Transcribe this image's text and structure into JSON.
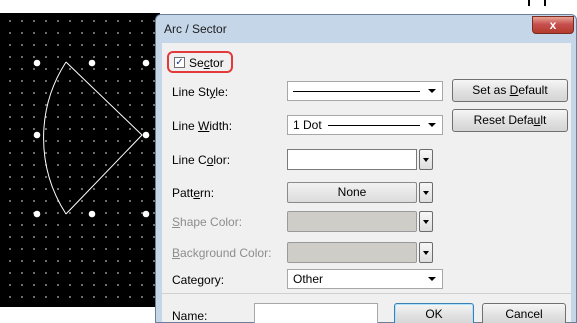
{
  "dialog": {
    "title": "Arc / Sector",
    "close_glyph": "x"
  },
  "sector": {
    "label_pre": "Se",
    "label_u": "c",
    "label_post": "tor",
    "checked": true,
    "check_glyph": "✓"
  },
  "fields": {
    "line_style": {
      "pre": "Line St",
      "u": "y",
      "post": "le:"
    },
    "line_width": {
      "pre": "Line ",
      "u": "W",
      "post": "idth:",
      "value": "1 Dot"
    },
    "line_color": {
      "pre": "Line C",
      "u": "o",
      "post": "lor:"
    },
    "pattern": {
      "pre": "Patt",
      "u": "e",
      "post": "rn:",
      "value": "None"
    },
    "shape_color": {
      "pre": "",
      "u": "S",
      "post": "hape Color:"
    },
    "background_color": {
      "pre": "",
      "u": "B",
      "post": "ackground Color:"
    },
    "category": {
      "pre": "Cate",
      "u": "g",
      "post": "ory:",
      "value": "Other"
    },
    "name": {
      "label": "Name:",
      "value": ""
    }
  },
  "buttons": {
    "set_default": {
      "pre": "Set as ",
      "u": "D",
      "post": "efault"
    },
    "reset_default": {
      "pre": "Reset Defa",
      "u": "u",
      "post": "lt"
    },
    "ok": "OK",
    "cancel": "Cancel"
  },
  "colors": {
    "canvas": "#000000",
    "shape_stroke": "#ffffff",
    "highlight": "#e23a3a",
    "dialog_frame": "#c6d6e9"
  }
}
